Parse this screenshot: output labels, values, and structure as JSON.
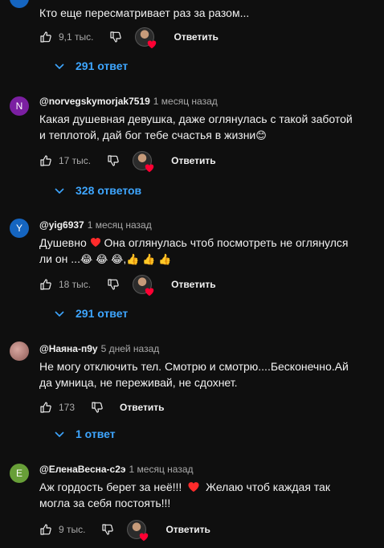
{
  "top_avatar_color": "#1565c0",
  "accent_colors": {
    "link": "#3ea6ff",
    "heart": "#ff0033"
  },
  "comments": [
    {
      "text": "Кто еще пересматривает раз за разом...",
      "likes": "9,1 тыс.",
      "reply_label": "Ответить",
      "replies_label": "291 ответ"
    },
    {
      "avatar_letter": "N",
      "avatar_color": "#7b1fa2",
      "author": "@norvegskymorjak7519",
      "time": "1 месяц назад",
      "text_line1": "Какая душевная девушка, даже оглянулась с такой заботой",
      "text_line2": "и теплотой, дай бог тебе счастья в жизни",
      "emoji2": "😊",
      "likes": "17 тыс.",
      "reply_label": "Ответить",
      "replies_label": "328 ответов"
    },
    {
      "avatar_letter": "Y",
      "avatar_color": "#1565c0",
      "author": "@yig6937",
      "time": "1 месяц назад",
      "text_line1_a": "Душевно",
      "text_line1_b": "Она оглянулась чтоб посмотреть не оглянулся",
      "text_line2": "ли он ...",
      "emoji_laugh": "😂",
      "emoji_thumb": "👍",
      "likes": "18 тыс.",
      "reply_label": "Ответить",
      "replies_label": "291 ответ"
    },
    {
      "author": "@Наяна-п9у",
      "time": "5 дней назад",
      "text_line1": "Не могу отключить тел. Смотрю и смотрю....Бесконечно.Ай",
      "text_line2": "да умница, не переживай, не сдохнет.",
      "likes": "173",
      "reply_label": "Ответить",
      "replies_label": "1 ответ"
    },
    {
      "avatar_letter": "E",
      "avatar_color": "#689f38",
      "author": "@ЕленаВесна-с2э",
      "time": "1 месяц назад",
      "text_line1_a": "Аж гордость берет за неё!!!",
      "text_line1_b": "Желаю чтоб каждая так",
      "text_line2": "могла за себя постоять!!!",
      "likes": "9 тыс.",
      "reply_label": "Ответить"
    }
  ]
}
